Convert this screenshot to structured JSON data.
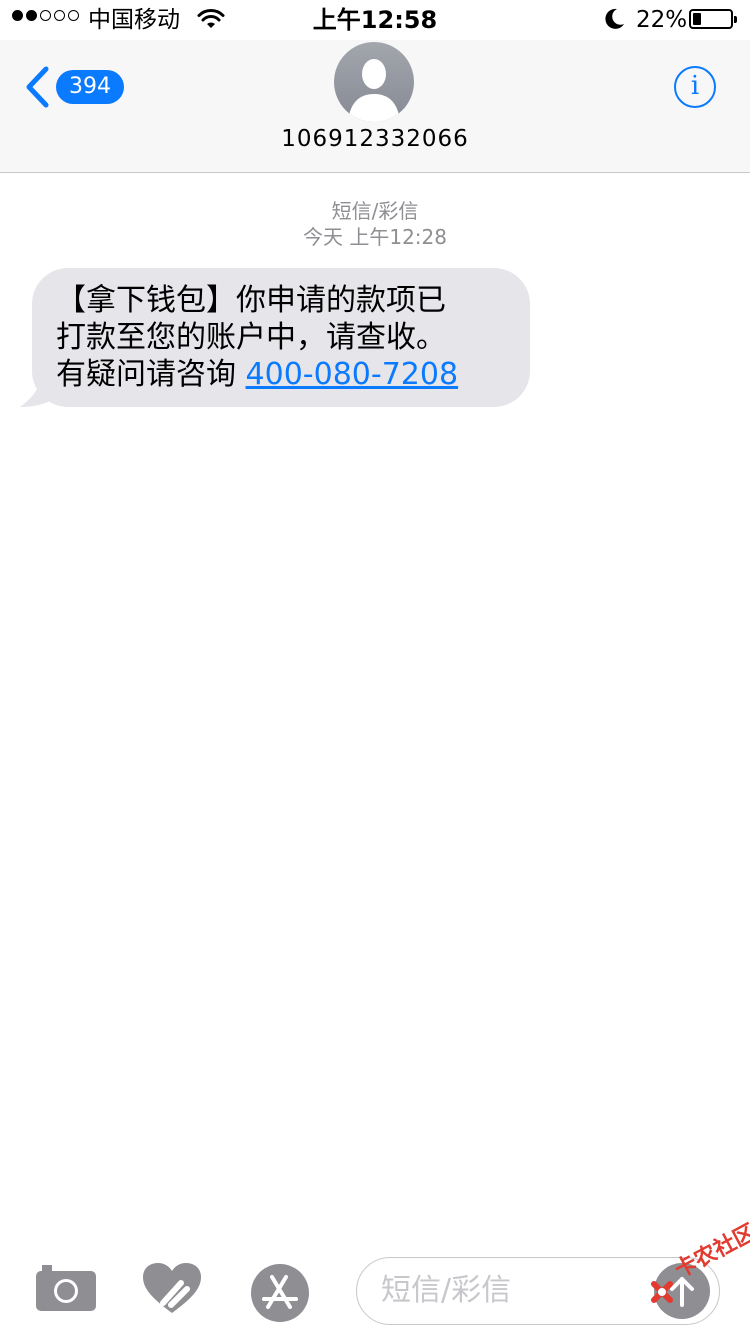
{
  "status_bar": {
    "signal_filled": 2,
    "signal_total": 5,
    "carrier": "中国移动",
    "time": "上午12:58",
    "battery_percent": "22%",
    "battery_level": 0.22
  },
  "header": {
    "back_badge": "394",
    "contact": "106912332066"
  },
  "conversation": {
    "message_type": "短信/彩信",
    "timestamp": "今天 上午12:28",
    "message": {
      "line1": "【拿下钱包】你申请的款项已",
      "line2": "打款至您的账户中，请查收。",
      "line3_prefix": "有疑问请咨询 ",
      "phone": "400-080-7208"
    }
  },
  "input_bar": {
    "placeholder": "短信/彩信",
    "value": ""
  },
  "watermark": {
    "text": "卡农社区"
  },
  "colors": {
    "accent": "#0a7aff",
    "bubble_incoming": "#e5e5ea",
    "meta_text": "#8e8e93",
    "icon_gray": "#8e8e93"
  }
}
